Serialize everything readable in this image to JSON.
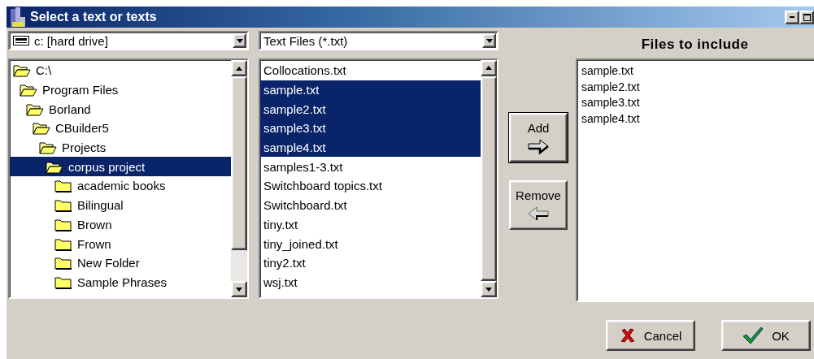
{
  "window": {
    "title": "Select a text or texts"
  },
  "drive_combo": {
    "value": "c: [hard drive]"
  },
  "filter_combo": {
    "value": "Text Files (*.txt)"
  },
  "folders": [
    {
      "label": "C:\\",
      "selected": false,
      "children": [
        {
          "label": "Program Files",
          "selected": false,
          "children": [
            {
              "label": "Borland",
              "selected": false,
              "children": [
                {
                  "label": "CBuilder5",
                  "selected": false,
                  "children": [
                    {
                      "label": "Projects",
                      "selected": false,
                      "children": [
                        {
                          "label": "corpus project",
                          "selected": true,
                          "children": [
                            {
                              "label": "academic books",
                              "selected": false
                            },
                            {
                              "label": "Bilingual",
                              "selected": false
                            },
                            {
                              "label": "Brown",
                              "selected": false
                            },
                            {
                              "label": "Frown",
                              "selected": false
                            },
                            {
                              "label": "New Folder",
                              "selected": false
                            },
                            {
                              "label": "Sample Phrases",
                              "selected": false
                            }
                          ]
                        }
                      ]
                    }
                  ]
                }
              ]
            }
          ]
        }
      ]
    }
  ],
  "files": [
    {
      "label": "Collocations.txt",
      "selected": false
    },
    {
      "label": "sample.txt",
      "selected": true
    },
    {
      "label": "sample2.txt",
      "selected": true
    },
    {
      "label": "sample3.txt",
      "selected": true
    },
    {
      "label": "sample4.txt",
      "selected": true
    },
    {
      "label": "samples1-3.txt",
      "selected": false
    },
    {
      "label": "Switchboard topics.txt",
      "selected": false
    },
    {
      "label": "Switchboard.txt",
      "selected": false
    },
    {
      "label": "tiny.txt",
      "selected": false
    },
    {
      "label": "tiny_joined.txt",
      "selected": false
    },
    {
      "label": "tiny2.txt",
      "selected": false
    },
    {
      "label": "wsj.txt",
      "selected": false
    }
  ],
  "add_button": {
    "label": "Add"
  },
  "remove_button": {
    "label": "Remove"
  },
  "included": {
    "heading": "Files to include",
    "items": [
      "sample.txt",
      "sample2.txt",
      "sample3.txt",
      "sample4.txt"
    ]
  },
  "buttons": [
    {
      "kind": "cancel",
      "label": "Cancel"
    },
    {
      "kind": "ok",
      "label": "OK"
    }
  ]
}
